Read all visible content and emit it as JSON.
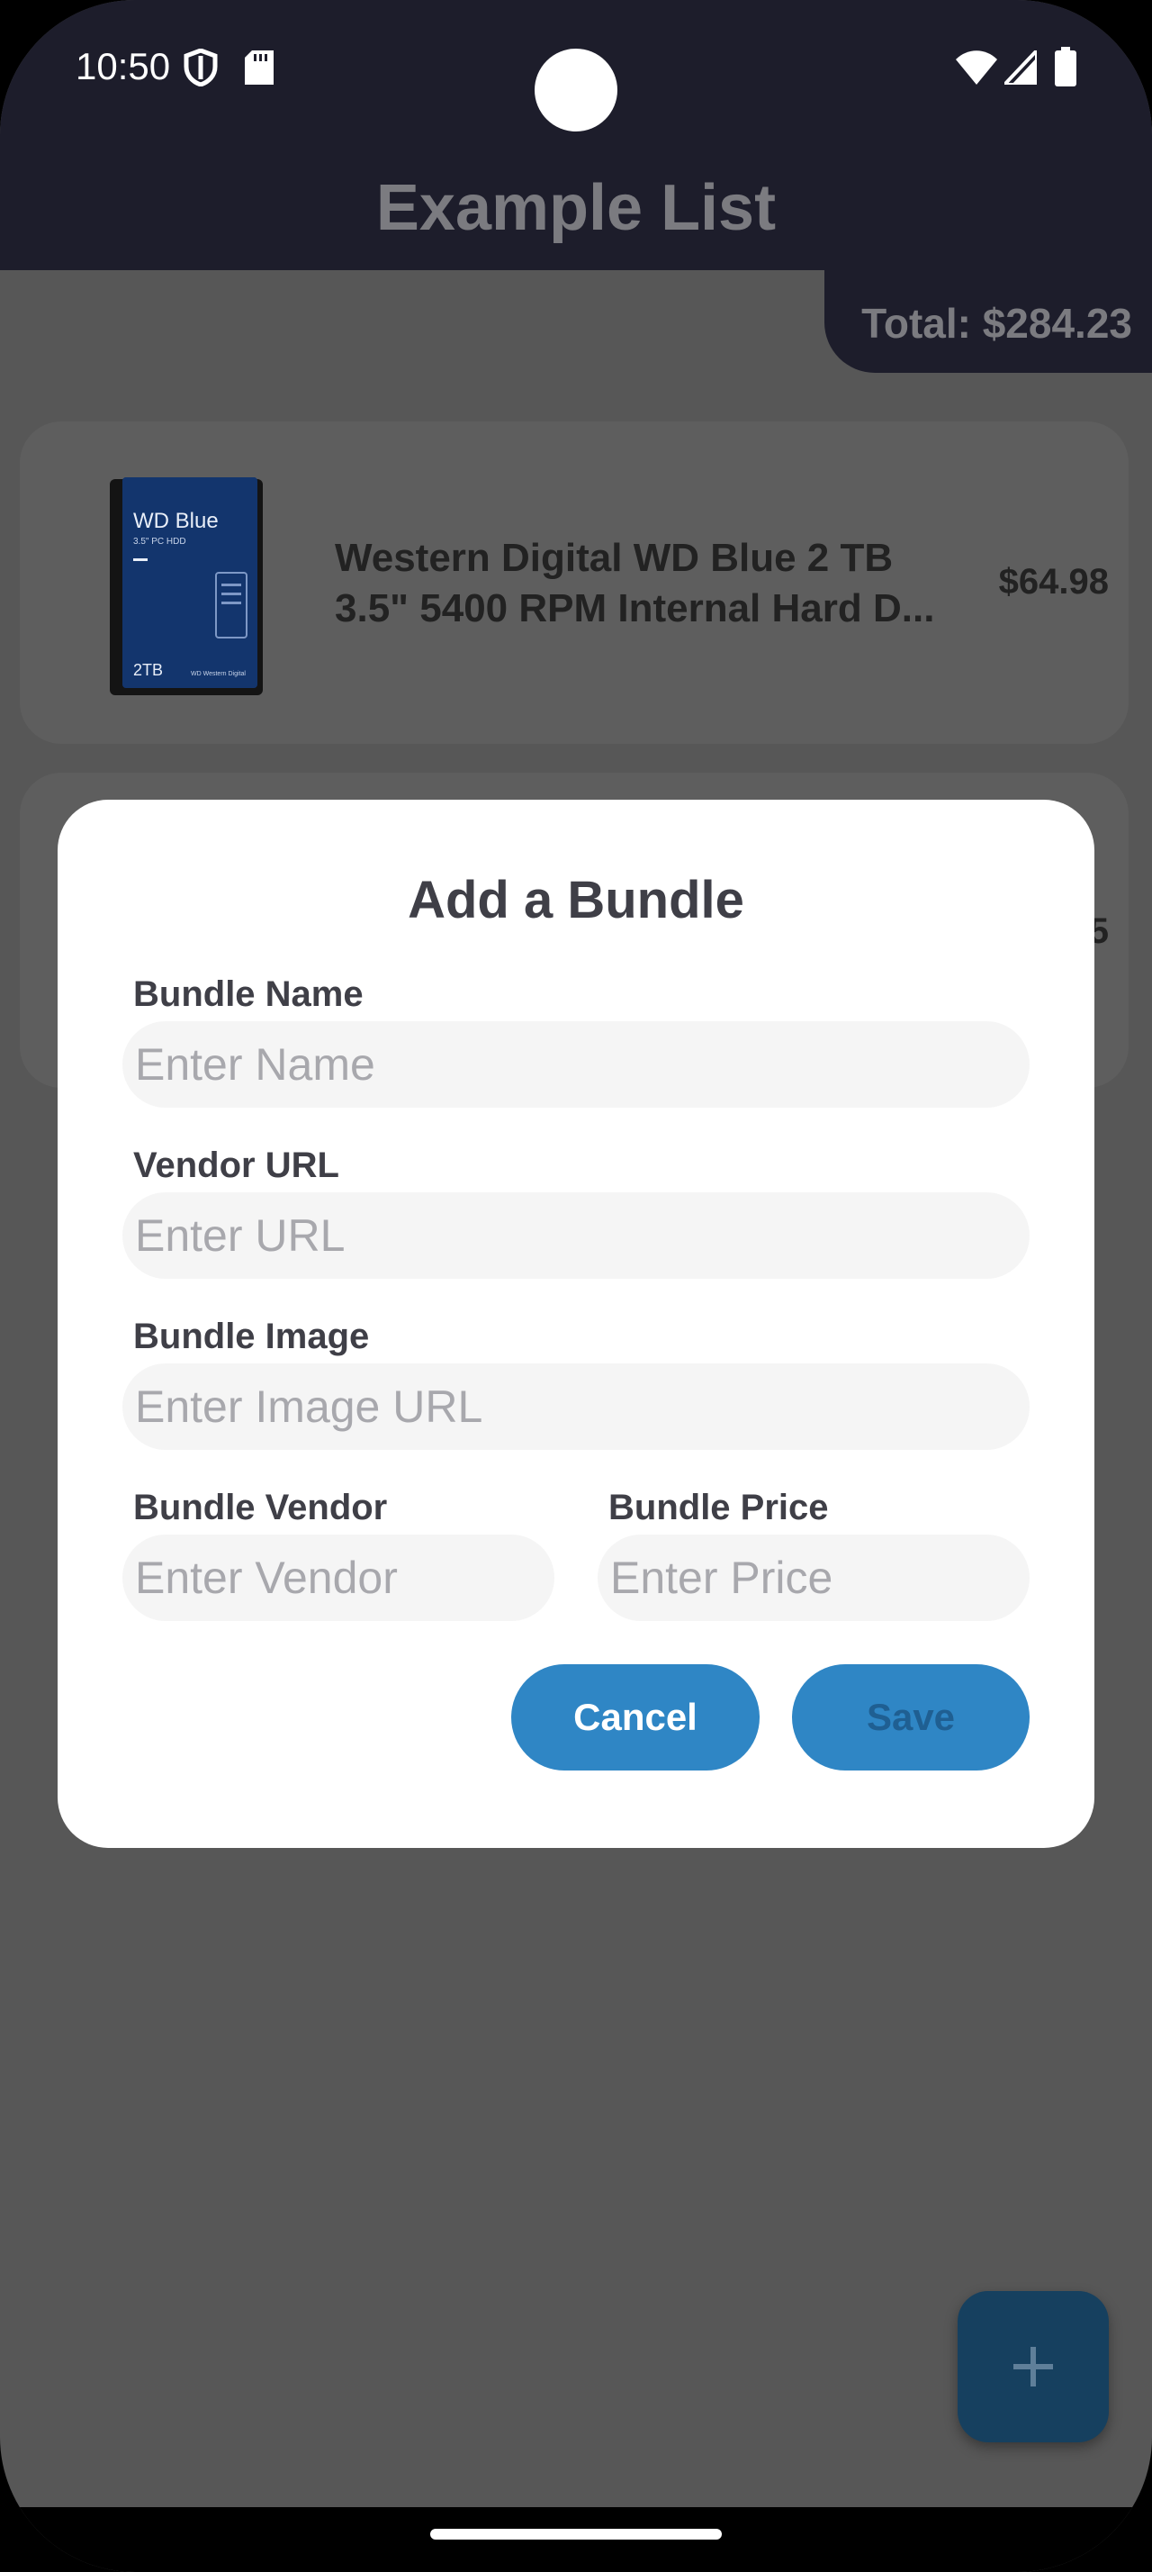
{
  "status_bar": {
    "time": "10:50",
    "icons": [
      "shield-icon",
      "sd-card-icon",
      "wifi-icon",
      "signal-icon",
      "battery-icon"
    ]
  },
  "app_bar": {
    "title": "Example List",
    "total": "Total: $284.23"
  },
  "list": {
    "items": [
      {
        "name_line1": "Western Digital WD Blue 2 TB",
        "name_line2": "3.5\" 5400 RPM Internal Hard D...",
        "price": "$64.98",
        "image": "hard-drive-image",
        "image_text": {
          "brand": "WD Blue",
          "spec": "3.5\" PC HDD",
          "capacity": "2TB",
          "maker": "WD Western Digital"
        }
      },
      {
        "price_fragment": "5"
      }
    ]
  },
  "dialog": {
    "title": "Add a Bundle",
    "bundle_name": {
      "label": "Bundle Name",
      "placeholder": "Enter Name",
      "value": ""
    },
    "vendor_url": {
      "label": "Vendor URL",
      "placeholder": "Enter URL",
      "value": ""
    },
    "bundle_image": {
      "label": "Bundle Image",
      "placeholder": "Enter Image URL",
      "value": ""
    },
    "bundle_vendor": {
      "label": "Bundle Vendor",
      "placeholder": "Enter Vendor",
      "value": ""
    },
    "bundle_price": {
      "label": "Bundle Price",
      "placeholder": "Enter Price",
      "value": ""
    },
    "cancel_label": "Cancel",
    "save_label": "Save"
  },
  "fab": {
    "icon": "plus-icon"
  },
  "colors": {
    "app_bar": "#1d1d2b",
    "scrim": "#575757",
    "accent": "#2f86c5",
    "fab": "#16405f"
  }
}
